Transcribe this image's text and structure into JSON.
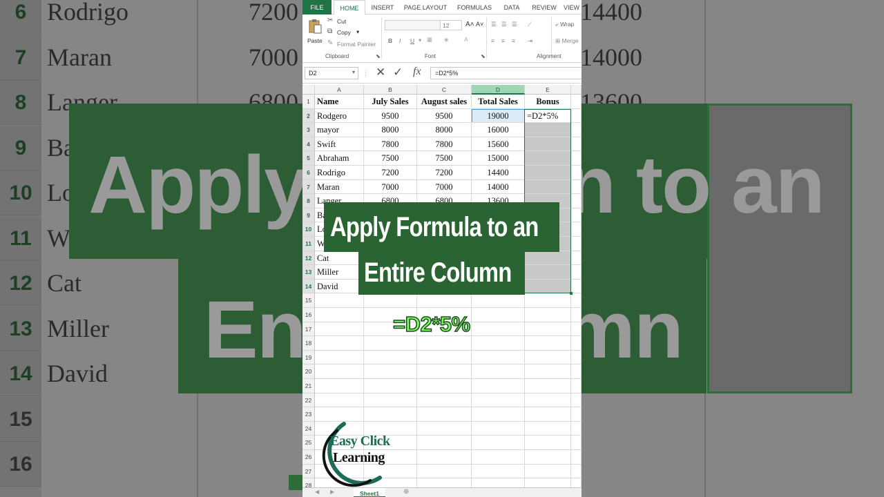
{
  "background_zoom": {
    "row_numbers": [
      "6",
      "7",
      "8",
      "9",
      "10",
      "11",
      "12",
      "13",
      "14",
      "15",
      "16"
    ],
    "names": [
      "Rodrigo",
      "Maran",
      "Langer",
      "Ba",
      "Lo",
      "W",
      "Cat",
      "Miller",
      "David"
    ],
    "july_values": [
      "7200",
      "7000",
      "6800"
    ],
    "total_values": [
      "14400",
      "14000",
      "13600"
    ],
    "big_title_left": "Apply",
    "big_title_right": "n to an",
    "big_bottom_left": "Ent",
    "big_bottom_right": "mn"
  },
  "ribbon": {
    "tabs": [
      "FILE",
      "HOME",
      "INSERT",
      "PAGE LAYOUT",
      "FORMULAS",
      "DATA",
      "REVIEW",
      "VIEW"
    ],
    "active_tab": "HOME",
    "clipboard": {
      "paste": "Paste",
      "cut": "Cut",
      "copy": "Copy",
      "format_painter": "Format Painter",
      "group_label": "Clipboard"
    },
    "font": {
      "size": "12",
      "bold": "B",
      "italic": "I",
      "underline": "U",
      "group_label": "Font"
    },
    "alignment": {
      "wrap": "Wrap",
      "merge": "Merge",
      "group_label": "Alignment"
    }
  },
  "formula_bar": {
    "name_box": "D2",
    "fx": "fx",
    "formula": "=D2*5%"
  },
  "grid": {
    "columns": [
      "A",
      "B",
      "C",
      "D",
      "E"
    ],
    "selected_column": "D",
    "headers": [
      "Name",
      "July Sales",
      "August sales",
      "Total Sales",
      "Bonus"
    ],
    "rows": [
      {
        "n": "2",
        "name": "Rodgero",
        "july": "9500",
        "aug": "9500",
        "total": "19000",
        "bonus": "=D2*5%"
      },
      {
        "n": "3",
        "name": "mayor",
        "july": "8000",
        "aug": "8000",
        "total": "16000",
        "bonus": ""
      },
      {
        "n": "4",
        "name": "Swift",
        "july": "7800",
        "aug": "7800",
        "total": "15600",
        "bonus": ""
      },
      {
        "n": "5",
        "name": "Abraham",
        "july": "7500",
        "aug": "7500",
        "total": "15000",
        "bonus": ""
      },
      {
        "n": "6",
        "name": "Rodrigo",
        "july": "7200",
        "aug": "7200",
        "total": "14400",
        "bonus": ""
      },
      {
        "n": "7",
        "name": "Maran",
        "july": "7000",
        "aug": "7000",
        "total": "14000",
        "bonus": ""
      },
      {
        "n": "8",
        "name": "Langer",
        "july": "6800",
        "aug": "6800",
        "total": "13600",
        "bonus": ""
      },
      {
        "n": "9",
        "name": "Ba",
        "july": "",
        "aug": "",
        "total": "",
        "bonus": ""
      },
      {
        "n": "10",
        "name": "Lo",
        "july": "",
        "aug": "",
        "total": "",
        "bonus": ""
      },
      {
        "n": "11",
        "name": "W",
        "july": "",
        "aug": "",
        "total": "",
        "bonus": ""
      },
      {
        "n": "12",
        "name": "Cat",
        "july": "",
        "aug": "",
        "total": "",
        "bonus": ""
      },
      {
        "n": "13",
        "name": "Miller",
        "july": "",
        "aug": "",
        "total": "",
        "bonus": ""
      },
      {
        "n": "14",
        "name": "David",
        "july": "",
        "aug": "",
        "total": "",
        "bonus": ""
      }
    ],
    "empty_rows": [
      "15",
      "16",
      "17",
      "18",
      "19",
      "20",
      "21",
      "22",
      "23",
      "24",
      "25",
      "26",
      "27",
      "28"
    ],
    "sheet_tab": "Sheet1"
  },
  "overlay": {
    "title_line1": "Apply Formula to an",
    "title_line2": "Entire Column",
    "formula_callout": "=D2*5%",
    "logo_line1": "Easy Click",
    "logo_line2": "Learning"
  },
  "colors": {
    "excel_green": "#217346",
    "title_bg": "#2b6433",
    "formula_callout": "#7dfb5b",
    "logo_teal": "#1f6b5a"
  }
}
